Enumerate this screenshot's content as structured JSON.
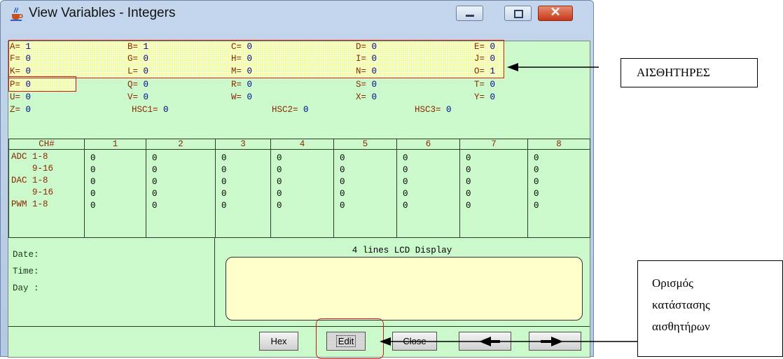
{
  "window": {
    "title": "View Variables - Integers",
    "close_glyph": "✕"
  },
  "variables": [
    {
      "n": "A=",
      "v": "1"
    },
    {
      "n": "B=",
      "v": "1"
    },
    {
      "n": "C=",
      "v": "0"
    },
    {
      "n": "D=",
      "v": "0"
    },
    {
      "n": "E=",
      "v": "0"
    },
    {
      "n": "F=",
      "v": "0"
    },
    {
      "n": "G=",
      "v": "0"
    },
    {
      "n": "H=",
      "v": "0"
    },
    {
      "n": "I=",
      "v": "0"
    },
    {
      "n": "J=",
      "v": "0"
    },
    {
      "n": "K=",
      "v": "0"
    },
    {
      "n": "L=",
      "v": "0"
    },
    {
      "n": "M=",
      "v": "0"
    },
    {
      "n": "N=",
      "v": "0"
    },
    {
      "n": "O=",
      "v": "1"
    },
    {
      "n": "P=",
      "v": "0"
    },
    {
      "n": "Q=",
      "v": "0"
    },
    {
      "n": "R=",
      "v": "0"
    },
    {
      "n": "S=",
      "v": "0"
    },
    {
      "n": "T=",
      "v": "0"
    },
    {
      "n": "U=",
      "v": "0"
    },
    {
      "n": "V=",
      "v": "0"
    },
    {
      "n": "W=",
      "v": "0"
    },
    {
      "n": "X=",
      "v": "0"
    },
    {
      "n": "Y=",
      "v": "0"
    },
    {
      "n": "Z=",
      "v": "0"
    },
    {
      "n": "HSC1=",
      "v": "0"
    },
    {
      "n": "HSC2=",
      "v": "0"
    },
    {
      "n": "HSC3=",
      "v": "0"
    }
  ],
  "channels": {
    "header": [
      "CH#",
      "1",
      "2",
      "3",
      "4",
      "5",
      "6",
      "7",
      "8"
    ],
    "row_labels": [
      "ADC 1-8",
      "    9-16",
      "DAC 1-8",
      "    9-16",
      "PWM 1-8"
    ],
    "columns": [
      [
        "0",
        "0",
        "0",
        "0",
        "0"
      ],
      [
        "0",
        "0",
        "0",
        "0",
        "0"
      ],
      [
        "0",
        "0",
        "0",
        "0",
        "0"
      ],
      [
        "0",
        "0",
        "0",
        "0",
        "0"
      ],
      [
        "0",
        "0",
        "0",
        "0",
        "0"
      ],
      [
        "0",
        "0",
        "0",
        "0",
        "0"
      ],
      [
        "0",
        "0",
        "0",
        "0",
        "0"
      ],
      [
        "0",
        "0",
        "0",
        "0",
        "0"
      ]
    ]
  },
  "info": {
    "date_label": "Date:",
    "time_label": "Time:",
    "day_label": "Day :"
  },
  "lcd": {
    "title": "4 lines LCD Display"
  },
  "buttons": {
    "hex": "Hex",
    "edit": "Edit",
    "close": "Close"
  },
  "annotations": {
    "sensors": "ΑΙΣΘΗΤΗΡΕΣ",
    "setting": [
      "Ορισμός",
      "κατάστασης",
      "αισθητήρων"
    ]
  },
  "colors": {
    "client_bg": "#ccf9cc",
    "highlight": "#f0fb9a",
    "annotation_red": "#cc1a1a",
    "lcd_bg": "#ffffcc"
  }
}
